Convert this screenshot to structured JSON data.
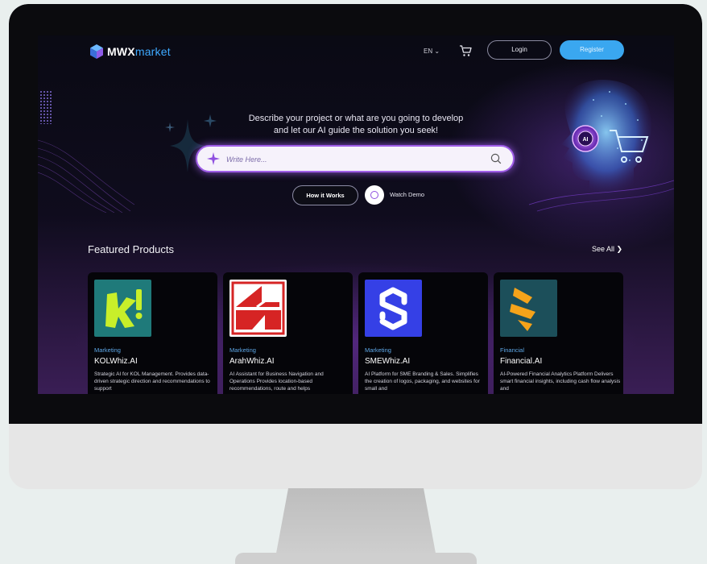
{
  "header": {
    "logo_main": "MWX",
    "logo_accent": "market",
    "language": "EN",
    "login_label": "Login",
    "register_label": "Register"
  },
  "hero": {
    "line1": "Describe your project or what are you going to develop",
    "line2": "and let our AI guide the solution you seek!",
    "search_placeholder": "Write Here...",
    "how_it_works_label": "How it Works",
    "watch_demo_label": "Watch Demo",
    "ai_badge": "AI"
  },
  "featured": {
    "title": "Featured Products",
    "see_all_label": "See All",
    "products": [
      {
        "category": "Marketing",
        "name": "KOLWhiz.AI",
        "description": "Strategic AI for KOL Management. Provides data-driven strategic direction and recommendations to support",
        "logo_bg": "#1f7a7a"
      },
      {
        "category": "Marketing",
        "name": "ArahWhiz.AI",
        "description": "AI Assistant for Business Navigation and Operations Provides location-based recommendations, route and helps",
        "logo_bg": "#ffffff"
      },
      {
        "category": "Marketing",
        "name": "SMEWhiz.AI",
        "description": "AI Platform for SME Branding & Sales. Simplifies the creation of logos, packaging, and websites for small and",
        "logo_bg": "#3540e6"
      },
      {
        "category": "Financial",
        "name": "Financial.AI",
        "description": "AI-Powered Financial Analytics Platform Delivers smart financial insights, including cash flow analysis and",
        "logo_bg": "#1c4f5a"
      }
    ]
  },
  "colors": {
    "accent_blue": "#3aa7f0",
    "accent_purple": "#a05ee8",
    "category_blue": "#5ea8e8"
  }
}
